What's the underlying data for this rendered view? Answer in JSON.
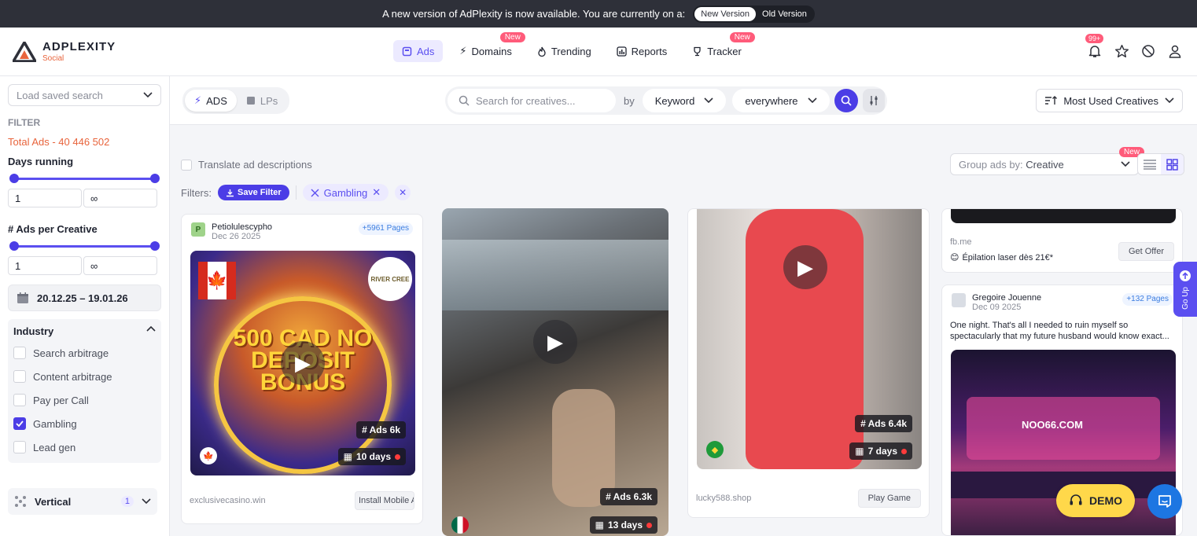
{
  "banner": {
    "text": "A new version of AdPlexity is now available. You are currently on a:",
    "new_version": "New Version",
    "old_version": "Old Version"
  },
  "brand": {
    "name": "ADPLEXITY",
    "sub": "Social"
  },
  "nav": [
    {
      "label": "Ads",
      "icon": "ads-icon",
      "active": true
    },
    {
      "label": "Domains",
      "icon": "bolt-icon",
      "badge": "New"
    },
    {
      "label": "Trending",
      "icon": "flame-icon"
    },
    {
      "label": "Reports",
      "icon": "chart-icon"
    },
    {
      "label": "Tracker",
      "icon": "trophy-icon",
      "badge": "New"
    }
  ],
  "header_icons": {
    "notifications_badge": "99+"
  },
  "sidebar": {
    "saved_search_placeholder": "Load saved search",
    "filter_heading": "FILTER",
    "total_ads": "Total Ads - 40 446 502",
    "days_running_label": "Days running",
    "days_min": "1",
    "days_max": "∞",
    "ads_per_creative_label": "# Ads per Creative",
    "apc_min": "1",
    "apc_max": "∞",
    "date_range": "20.12.25 – 19.01.26",
    "industry_label": "Industry",
    "industry_options": [
      {
        "label": "Search arbitrage",
        "checked": false
      },
      {
        "label": "Content arbitrage",
        "checked": false
      },
      {
        "label": "Pay per Call",
        "checked": false
      },
      {
        "label": "Gambling",
        "checked": true
      },
      {
        "label": "Lead gen",
        "checked": false
      }
    ],
    "vertical_label": "Vertical",
    "vertical_count": "1"
  },
  "toolbar": {
    "ads_tab": "ADS",
    "lps_tab": "LPs",
    "search_placeholder": "Search for creatives...",
    "by_label": "by",
    "search_by": "Keyword",
    "search_scope": "everywhere",
    "sort_label": "Most Used Creatives"
  },
  "main": {
    "translate_label": "Translate ad descriptions",
    "group_by_label": "Group ads by:",
    "group_by_value": "Creative",
    "group_badge": "New",
    "filters_label": "Filters:",
    "save_filter": "Save Filter",
    "active_filter": "Gambling"
  },
  "cards": [
    {
      "advertiser": "Petiolulescypho",
      "avatar": "P",
      "date": "Dec 26 2025",
      "pages": "+5961 Pages",
      "creative_text": "500 CAD NO DEPOSIT BONUS",
      "brand_text": "RIVER CREE",
      "ads": "# Ads 6k",
      "days": "10 days",
      "domain": "exclusivecasino.win",
      "cta": "Install Mobile App"
    },
    {
      "ads": "# Ads 6.3k",
      "days": "13 days"
    },
    {
      "ads": "# Ads 6.4k",
      "days": "7 days",
      "domain": "lucky588.shop",
      "cta": "Play Game"
    },
    {
      "domain": "fb.me",
      "description": "Épilation laser dès 21€*",
      "cta": "Get Offer"
    },
    {
      "advertiser": "Gregoire Jouenne",
      "date": "Dec 09 2025",
      "pages": "+132 Pages",
      "description": "One night. That's all I needed to ruin myself so spectacularly that my future husband would know exact...",
      "creative_text": "NOO66.COM"
    }
  ],
  "widgets": {
    "go_up": "Go Up",
    "demo": "DEMO"
  },
  "colors": {
    "accent": "#4b3de6",
    "badge": "#ff5b7a",
    "total_ads": "#e8643c",
    "demo": "#ffd84a"
  }
}
